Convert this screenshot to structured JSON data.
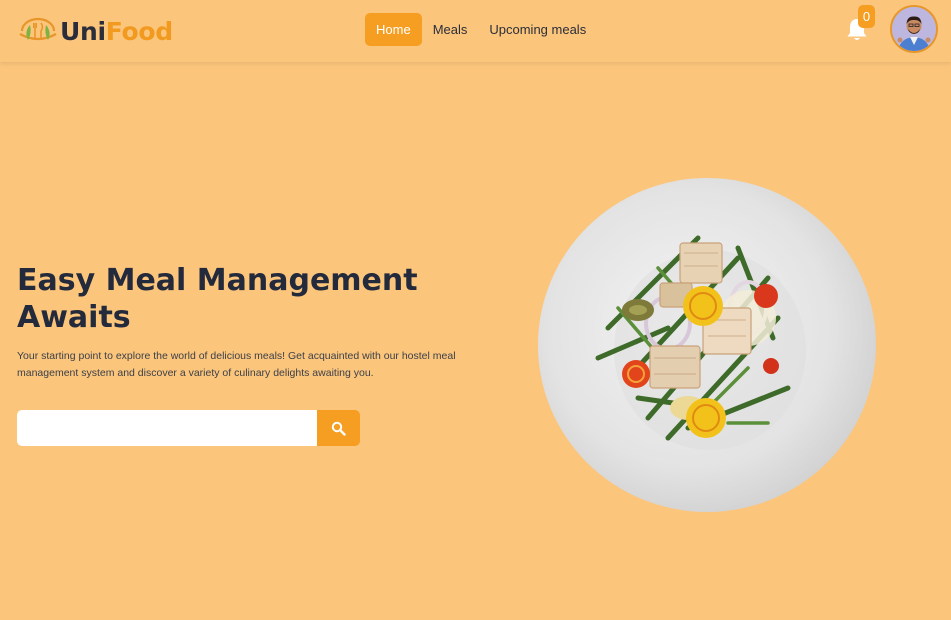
{
  "brand": {
    "part1": "Uni",
    "part2": "Food"
  },
  "nav": {
    "items": [
      {
        "label": "Home",
        "active": true
      },
      {
        "label": "Meals",
        "active": false
      },
      {
        "label": "Upcoming meals",
        "active": false
      }
    ]
  },
  "notifications": {
    "count": "0",
    "icon": "bell-icon"
  },
  "user": {
    "avatar": "user-avatar"
  },
  "hero": {
    "title": "Easy Meal Management Awaits",
    "description": "Your starting point to explore the world of delicious meals! Get acquainted with our hostel meal management system and discover a variety of culinary delights awaiting you.",
    "search": {
      "placeholder": "",
      "value": "",
      "icon": "search-icon"
    },
    "image": "plated-salad-with-fish"
  },
  "colors": {
    "background": "#fbc57c",
    "accent": "#f59e22",
    "brand_dark": "#2b2e3a",
    "brand_orange": "#f29a1f",
    "heading": "#232a3b"
  }
}
